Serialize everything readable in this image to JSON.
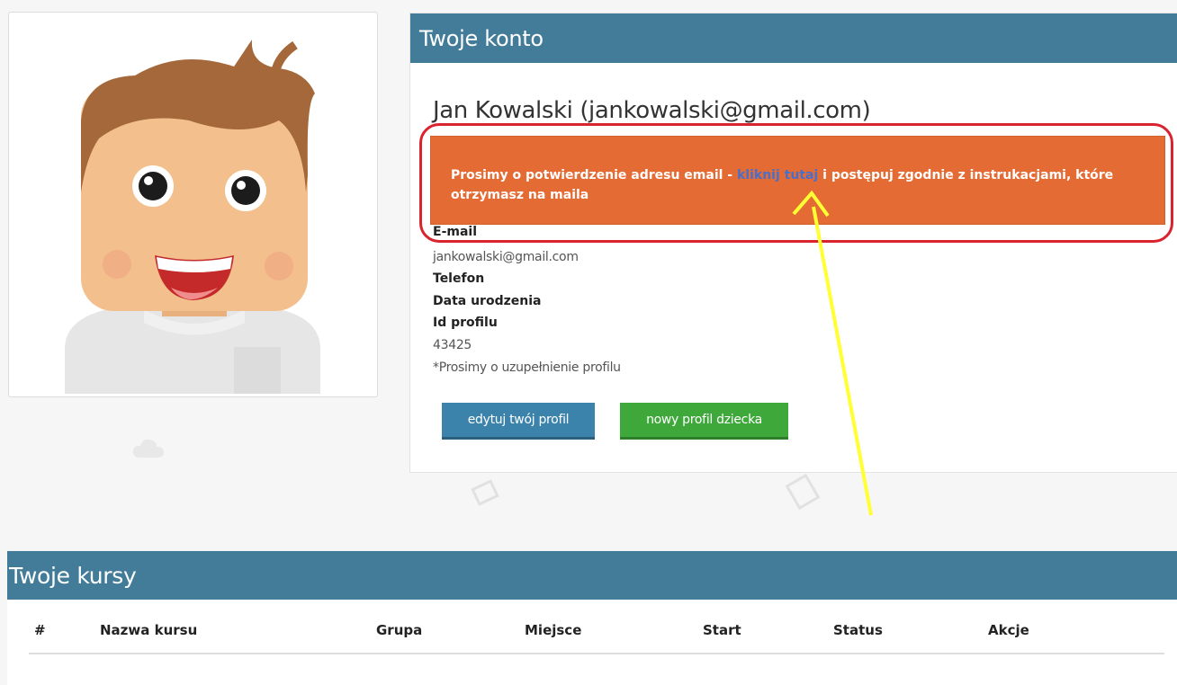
{
  "account": {
    "title": "Twoje konto",
    "user_name": "Jan Kowalski (jankowalski@gmail.com)",
    "alert": {
      "text_before": "Prosimy o potwierdzenie adresu email - ",
      "link_text": "kliknij tutaj",
      "text_after": " i postępuj zgodnie z instrukacjami, które otrzymasz na maila"
    },
    "fields": {
      "email_label": "E-mail",
      "email_value": "jankowalski@gmail.com",
      "phone_label": "Telefon",
      "birthdate_label": "Data urodzenia",
      "profile_id_label": "Id profilu",
      "profile_id_value": "43425",
      "note": "*Prosimy o uzupełnienie profilu"
    },
    "buttons": {
      "edit_profile": "edytuj twój profil",
      "new_child_profile": "nowy profil dziecka"
    }
  },
  "courses": {
    "title": "Twoje kursy",
    "columns": [
      "#",
      "Nazwa kursu",
      "Grupa",
      "Miejsce",
      "Start",
      "Status",
      "Akcje"
    ]
  },
  "colors": {
    "header_bg": "#437c98",
    "alert_bg": "#e56b34",
    "highlight_ring": "#d9232e",
    "annotation_arrow": "#ffff33",
    "edit_button": "#3c83ac",
    "child_button": "#3ea83a"
  }
}
